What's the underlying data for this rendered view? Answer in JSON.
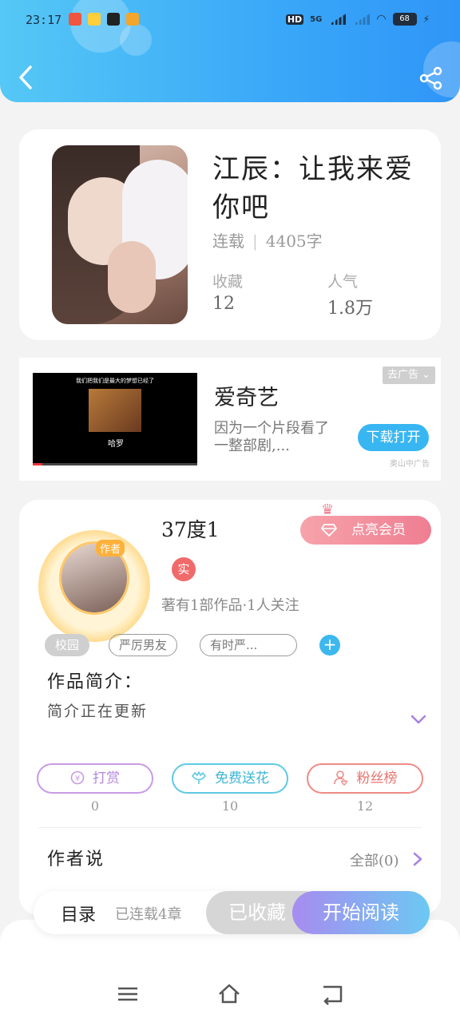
{
  "status_bar": {
    "time": "23:17",
    "hd": "HD",
    "network": "5G",
    "battery": "68",
    "app_icon_colors": [
      "#f0553f",
      "#ffcf3a",
      "#222222",
      "#f3a62b"
    ]
  },
  "header": {
    "back_icon": "chevron-left-icon",
    "share_icon": "share-icon",
    "gradient": [
      "#55c8f6",
      "#2f95f7"
    ]
  },
  "book": {
    "title": "江辰：让我来爱你吧",
    "status": "连载",
    "word_count": "4405字",
    "favorites_label": "收藏",
    "favorites_value": "12",
    "popularity_label": "人气",
    "popularity_value": "1.8万"
  },
  "ad": {
    "close_label": "去广告",
    "title": "爱奇艺",
    "description": "因为一个片段看了一整部剧,...",
    "button_label": "下载打开",
    "source": "奥山中广告",
    "video_caption": "我们把我们是最大的梦想已经了",
    "video_logo": "哈罗"
  },
  "author": {
    "badge": "作者",
    "name": "37度1",
    "vip_button": "点亮会员",
    "verified_label": "实",
    "stats": "著有1部作品·1人关注",
    "tags": [
      "校园",
      "严厉男友",
      "有时严..."
    ],
    "intro_label": "作品简介：",
    "intro_text": "简介正在更新",
    "actions": [
      {
        "label": "打赏",
        "count": "0",
        "icon": "coin-icon",
        "color": "#c99ae6"
      },
      {
        "label": "免费送花",
        "count": "10",
        "icon": "flower-icon",
        "color": "#5ec9e3"
      },
      {
        "label": "粉丝榜",
        "count": "12",
        "icon": "fans-icon",
        "color": "#f08a86"
      }
    ],
    "says_label": "作者说",
    "says_all": "全部(0)"
  },
  "bottom_bar": {
    "catalog": "目录",
    "chapters": "已连载4章",
    "collected": "已收藏",
    "start_reading": "开始阅读"
  },
  "navbar": {
    "menu_icon": "menu-icon",
    "home_icon": "home-icon",
    "back_icon": "back-icon"
  },
  "colors": {
    "accent": "#3aa8f8",
    "vip": "#ef7e92",
    "verified": "#f06a6a",
    "expand": "#a783e0"
  }
}
